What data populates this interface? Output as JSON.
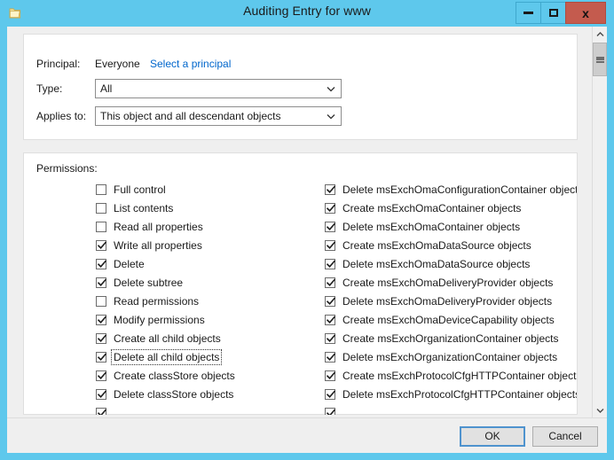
{
  "window": {
    "title": "Auditing Entry for www",
    "icon": "folder-icon",
    "accent_color": "#5ec8ec",
    "close_color": "#c45b4e",
    "caption": {
      "minimize_label": "Minimize",
      "maximize_label": "Maximize",
      "close_label": "x"
    }
  },
  "header": {
    "principal_label": "Principal:",
    "principal_value": "Everyone",
    "select_principal_link": "Select a principal",
    "type_label": "Type:",
    "type_value": "All",
    "applies_to_label": "Applies to:",
    "applies_to_value": "This object and all descendant objects"
  },
  "permissions": {
    "section_label": "Permissions:",
    "left_column": [
      {
        "label": "Full control",
        "checked": false,
        "focused": false
      },
      {
        "label": "List contents",
        "checked": false,
        "focused": false
      },
      {
        "label": "Read all properties",
        "checked": false,
        "focused": false
      },
      {
        "label": "Write all properties",
        "checked": true,
        "focused": false
      },
      {
        "label": "Delete",
        "checked": true,
        "focused": false
      },
      {
        "label": "Delete subtree",
        "checked": true,
        "focused": false
      },
      {
        "label": "Read permissions",
        "checked": false,
        "focused": false
      },
      {
        "label": "Modify permissions",
        "checked": true,
        "focused": false
      },
      {
        "label": "Create all child objects",
        "checked": true,
        "focused": false
      },
      {
        "label": "Delete all child objects",
        "checked": true,
        "focused": true
      },
      {
        "label": "Create classStore objects",
        "checked": true,
        "focused": false
      },
      {
        "label": "Delete classStore objects",
        "checked": true,
        "focused": false
      },
      {
        "label": "",
        "checked": true,
        "focused": false
      }
    ],
    "right_column": [
      {
        "label": "Delete msExchOmaConfigurationContainer objects",
        "checked": true,
        "focused": false
      },
      {
        "label": "Create msExchOmaContainer objects",
        "checked": true,
        "focused": false
      },
      {
        "label": "Delete msExchOmaContainer objects",
        "checked": true,
        "focused": false
      },
      {
        "label": "Create msExchOmaDataSource objects",
        "checked": true,
        "focused": false
      },
      {
        "label": "Delete msExchOmaDataSource objects",
        "checked": true,
        "focused": false
      },
      {
        "label": "Create msExchOmaDeliveryProvider objects",
        "checked": true,
        "focused": false
      },
      {
        "label": "Delete msExchOmaDeliveryProvider objects",
        "checked": true,
        "focused": false
      },
      {
        "label": "Create msExchOmaDeviceCapability objects",
        "checked": true,
        "focused": false
      },
      {
        "label": "Create msExchOrganizationContainer objects",
        "checked": true,
        "focused": false
      },
      {
        "label": "Delete msExchOrganizationContainer objects",
        "checked": true,
        "focused": false
      },
      {
        "label": "Create msExchProtocolCfgHTTPContainer objects",
        "checked": true,
        "focused": false
      },
      {
        "label": "Delete msExchProtocolCfgHTTPContainer objects",
        "checked": true,
        "focused": false
      },
      {
        "label": "",
        "checked": true,
        "focused": false
      }
    ]
  },
  "footer": {
    "ok_label": "OK",
    "cancel_label": "Cancel"
  },
  "scrollbar": {
    "up_arrow": "chevron-up-icon",
    "down_arrow": "chevron-down-icon"
  }
}
